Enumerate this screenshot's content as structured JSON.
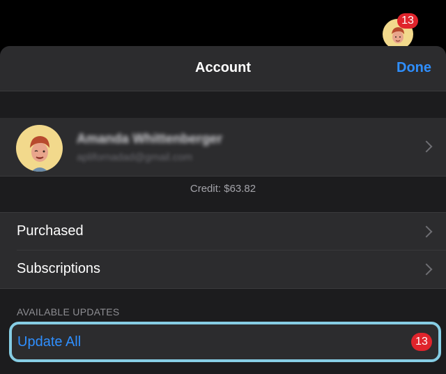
{
  "top": {
    "badge_count": "13"
  },
  "navbar": {
    "title": "Account",
    "done_label": "Done"
  },
  "account": {
    "name": "Amanda Whittenberger",
    "email": "aplifornadad@gmail.com",
    "credit": "Credit: $63.82"
  },
  "menu": [
    {
      "label": "Purchased"
    },
    {
      "label": "Subscriptions"
    }
  ],
  "updates": {
    "section_header": "AVAILABLE UPDATES",
    "update_all_label": "Update All",
    "badge_count": "13"
  },
  "colors": {
    "accent": "#2f8fff",
    "badge": "#e0242c",
    "highlight_outline": "#86cde4",
    "cell_background": "#2c2c2e",
    "sheet_background": "#1c1c1e"
  },
  "icons": {
    "avatar": "memoji-avatar",
    "chevron": "chevron-right-icon"
  }
}
